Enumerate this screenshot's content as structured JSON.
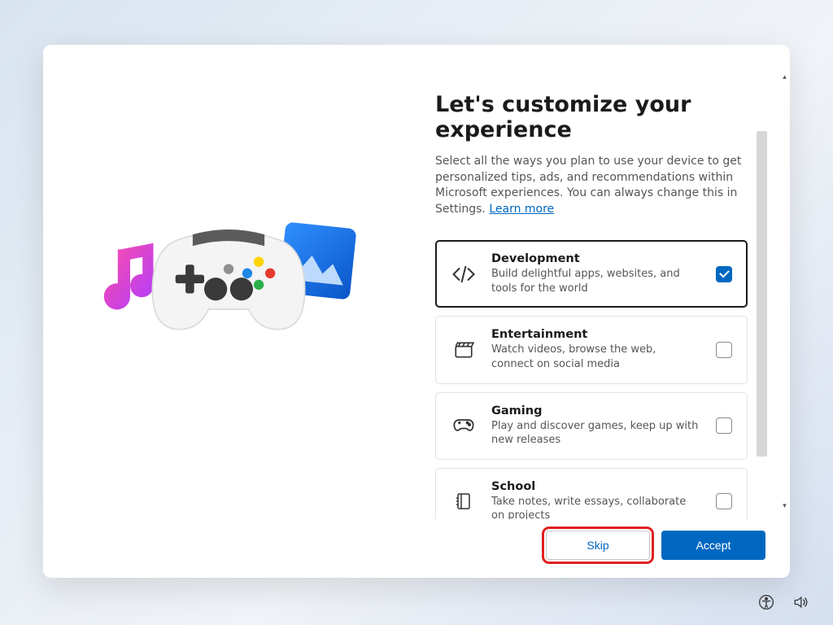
{
  "title": "Let's customize your experience",
  "subtitle_prefix": "Select all the ways you plan to use your device to get personalized tips, ads, and recommendations within Microsoft experiences. You can always change this in Settings. ",
  "learn_more": "Learn more",
  "cards": [
    {
      "id": "development",
      "title": "Development",
      "desc": "Build delightful apps, websites, and tools for the world",
      "checked": true,
      "icon": "code"
    },
    {
      "id": "entertainment",
      "title": "Entertainment",
      "desc": "Watch videos, browse the web, connect on social media",
      "checked": false,
      "icon": "clapper"
    },
    {
      "id": "gaming",
      "title": "Gaming",
      "desc": "Play and discover games, keep up with new releases",
      "checked": false,
      "icon": "gamepad"
    },
    {
      "id": "school",
      "title": "School",
      "desc": "Take notes, write essays, collaborate on projects",
      "checked": false,
      "icon": "notebook"
    }
  ],
  "buttons": {
    "skip": "Skip",
    "accept": "Accept"
  },
  "colors": {
    "accent": "#0067c0",
    "highlight": "#e02020"
  }
}
